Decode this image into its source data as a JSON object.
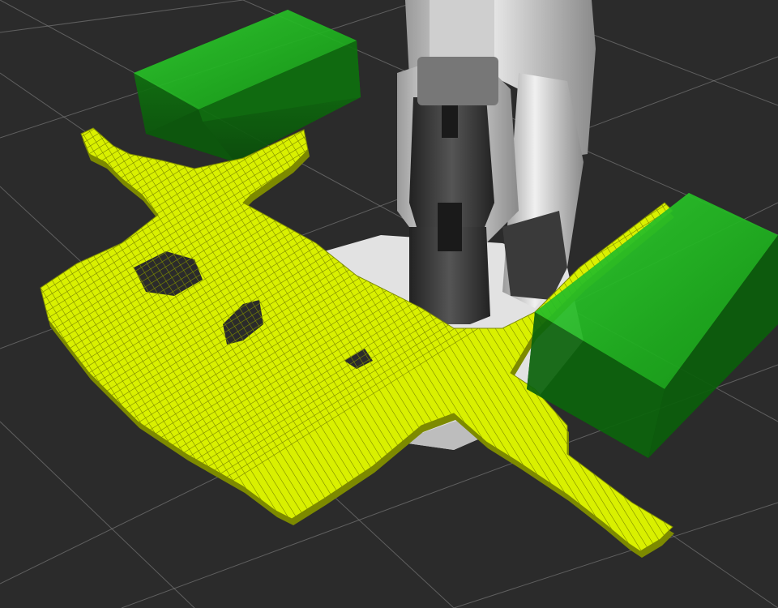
{
  "scene": {
    "background_color": "#2b2b2b",
    "grid_color": "#8a8a8a",
    "voxel_color": "#d9f000",
    "voxel_edge_color": "#7d8a00",
    "box_color": "#1fae1f",
    "box_dark_color": "#0d6a0d",
    "robot_light_color": "#d8d8d8",
    "robot_dark_color": "#3c3c3c",
    "objects": [
      {
        "name": "green-box-back",
        "type": "box"
      },
      {
        "name": "green-box-right",
        "type": "box"
      },
      {
        "name": "robot-arm",
        "type": "robot"
      },
      {
        "name": "voxel-occupancy-map",
        "type": "voxels"
      }
    ]
  }
}
